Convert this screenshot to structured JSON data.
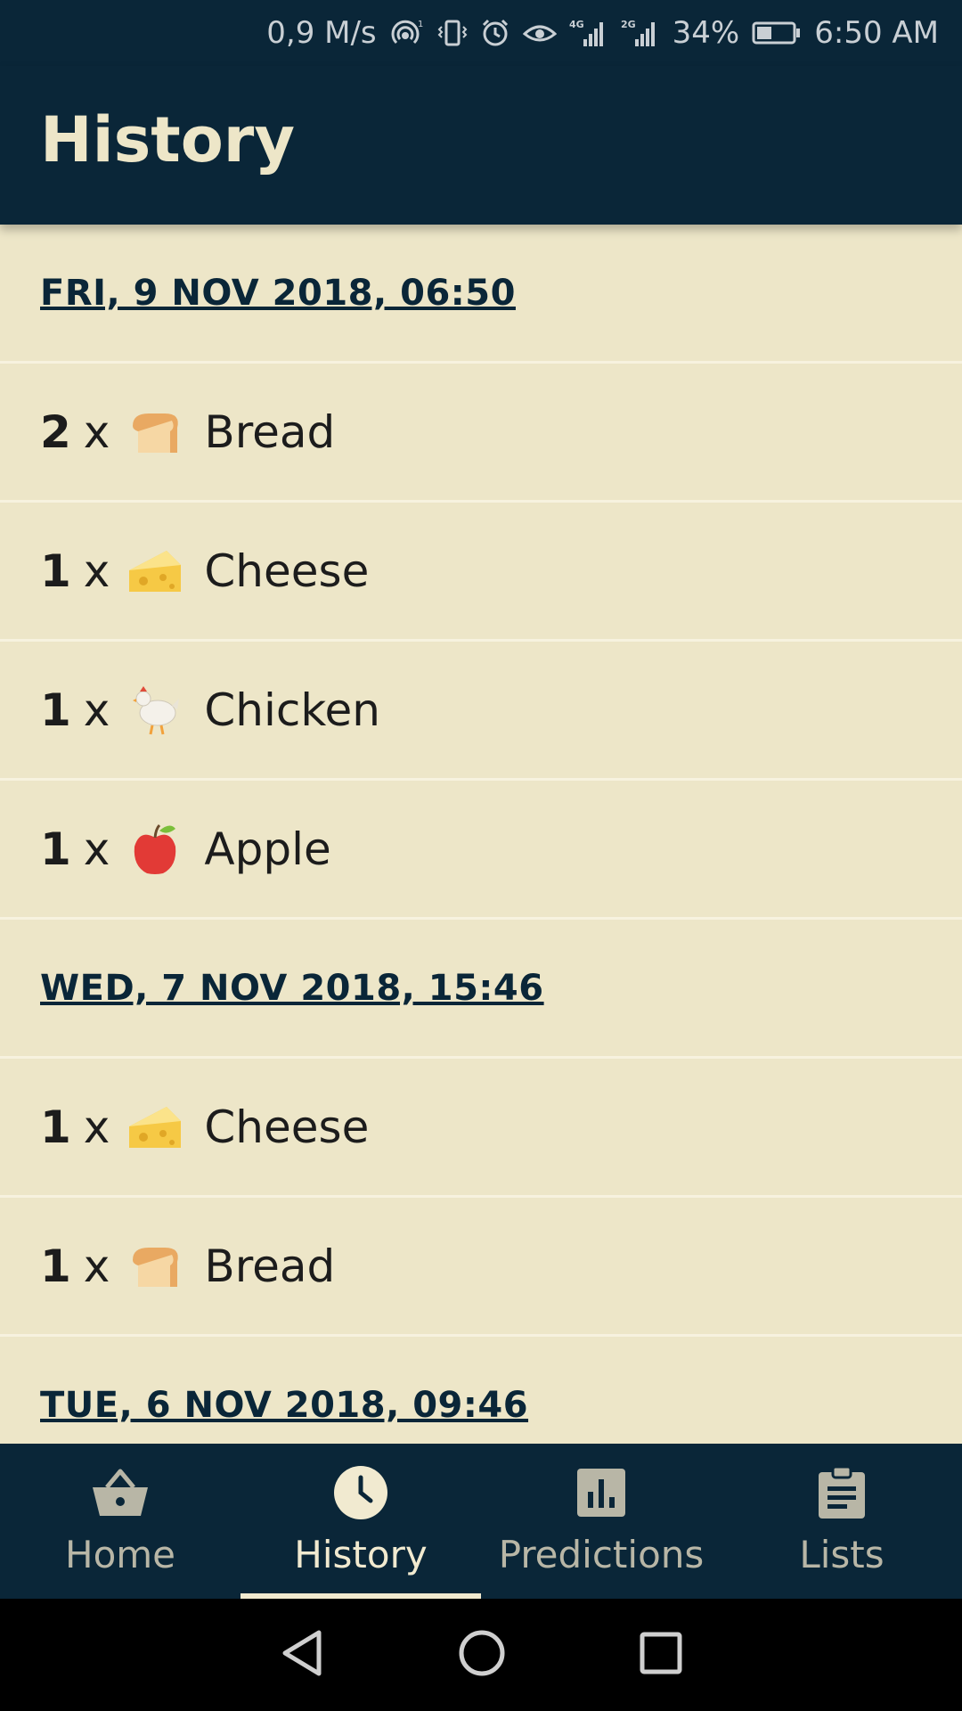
{
  "status_bar": {
    "speed": "0,9 M/s",
    "battery_pct": "34%",
    "time": "6:50 AM",
    "icons": [
      "hotspot-icon",
      "vibrate-icon",
      "alarm-icon",
      "eye-icon",
      "signal-4g-icon",
      "signal-2g-icon",
      "battery-icon"
    ]
  },
  "header": {
    "title": "History"
  },
  "history": {
    "group1": {
      "date": "FRI, 9 NOV 2018, 06:50",
      "items": [
        {
          "qty": "2",
          "x": "x",
          "name": "Bread",
          "icon": "bread-emoji"
        },
        {
          "qty": "1",
          "x": "x",
          "name": "Cheese",
          "icon": "cheese-emoji"
        },
        {
          "qty": "1",
          "x": "x",
          "name": "Chicken",
          "icon": "chicken-emoji"
        },
        {
          "qty": "1",
          "x": "x",
          "name": "Apple",
          "icon": "apple-emoji"
        }
      ]
    },
    "group2": {
      "date": "WED, 7 NOV 2018, 15:46",
      "items": [
        {
          "qty": "1",
          "x": "x",
          "name": "Cheese",
          "icon": "cheese-emoji"
        },
        {
          "qty": "1",
          "x": "x",
          "name": "Bread",
          "icon": "bread-emoji"
        }
      ]
    },
    "group3": {
      "date": "TUE, 6 NOV 2018, 09:46"
    }
  },
  "bottom_nav": {
    "tabs": [
      {
        "label": "Home",
        "icon": "basket-icon",
        "active": false
      },
      {
        "label": "History",
        "icon": "clock-icon",
        "active": true
      },
      {
        "label": "Predictions",
        "icon": "bar-chart-icon",
        "active": false
      },
      {
        "label": "Lists",
        "icon": "clipboard-icon",
        "active": false
      }
    ]
  },
  "system_nav": {
    "icons": [
      "back-icon",
      "home-circle-icon",
      "recents-icon"
    ]
  },
  "colors": {
    "primary_dark": "#0a2638",
    "background": "#ede6c8",
    "accent_light": "#f1ead0",
    "inactive": "#b8b6a6"
  }
}
